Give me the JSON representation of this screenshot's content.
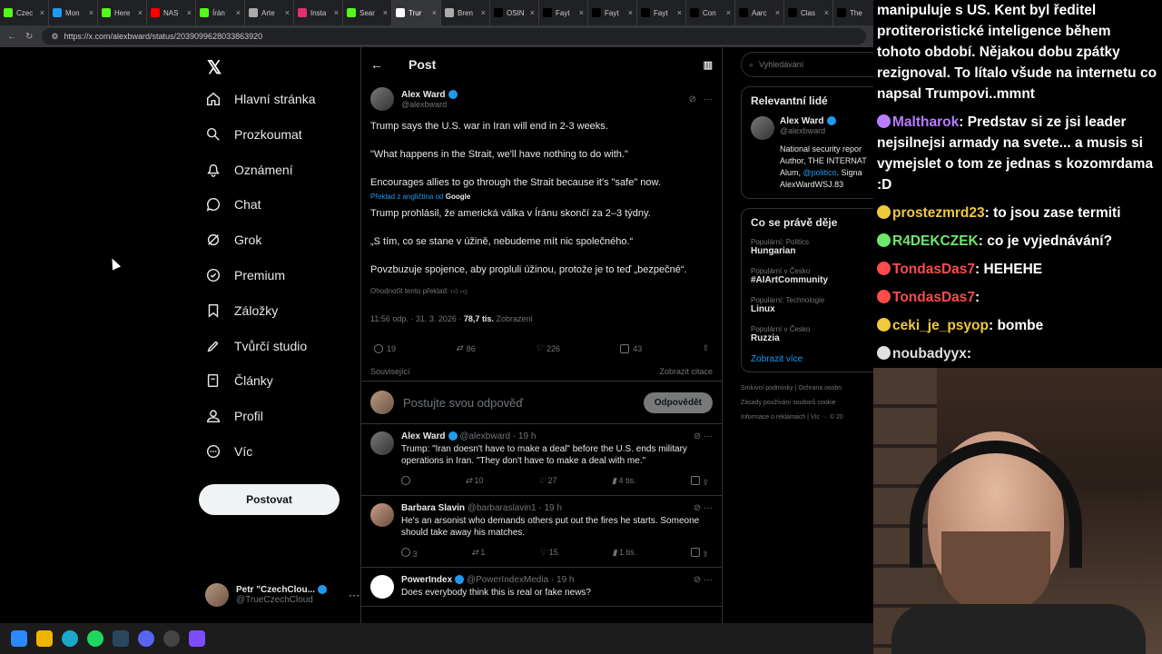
{
  "browser": {
    "tabs": [
      {
        "label": "Czec",
        "color": "#53fc18"
      },
      {
        "label": "Mon",
        "color": "#1d9bf0"
      },
      {
        "label": "Here",
        "color": "#53fc18"
      },
      {
        "label": "NAS",
        "color": "#ff0000"
      },
      {
        "label": "Írán",
        "color": "#53fc18"
      },
      {
        "label": "Arte",
        "color": "#aaaaaa"
      },
      {
        "label": "Insta",
        "color": "#e1306c"
      },
      {
        "label": "Sear",
        "color": "#53fc18"
      },
      {
        "label": "Trur",
        "color": "#ffffff"
      },
      {
        "label": "Bren",
        "color": "#aaaaaa"
      },
      {
        "label": "OSIN",
        "color": "#000000"
      },
      {
        "label": "Fayt",
        "color": "#000000"
      },
      {
        "label": "Fayt",
        "color": "#000000"
      },
      {
        "label": "Fayt",
        "color": "#000000"
      },
      {
        "label": "Con",
        "color": "#000000"
      },
      {
        "label": "Aarc",
        "color": "#000000"
      },
      {
        "label": "Clas",
        "color": "#000000"
      },
      {
        "label": "The",
        "color": "#000000"
      }
    ],
    "url": "https://x.com/alexbward/status/2039099628033863920"
  },
  "nav": {
    "items": [
      {
        "label": "Hlavní stránka",
        "icon": "home-icon"
      },
      {
        "label": "Prozkoumat",
        "icon": "search-icon"
      },
      {
        "label": "Oznámení",
        "icon": "bell-icon"
      },
      {
        "label": "Chat",
        "icon": "chat-icon"
      },
      {
        "label": "Grok",
        "icon": "grok-icon"
      },
      {
        "label": "Premium",
        "icon": "premium-icon"
      },
      {
        "label": "Záložky",
        "icon": "bookmark-icon"
      },
      {
        "label": "Tvůrčí studio",
        "icon": "rocket-icon"
      },
      {
        "label": "Články",
        "icon": "article-icon"
      },
      {
        "label": "Profil",
        "icon": "person-icon"
      },
      {
        "label": "Víc",
        "icon": "more-icon"
      }
    ],
    "post_label": "Postovat",
    "me_name": "Petr \"CzechClou...",
    "me_handle": "@TrueCzechCloud"
  },
  "main": {
    "title": "Post",
    "tweet": {
      "name": "Alex Ward",
      "handle": "@alexbward",
      "p1": "Trump says the U.S. war in Iran will end in 2-3 weeks.",
      "p2": "\"What happens in the Strait, we'll have nothing to do with.\"",
      "p3": "Encourages allies to go through the Strait because it's \"safe\" now.",
      "translated_from": "Překlad z angličtina od",
      "google": "Google",
      "t1": "Trump prohlásil, že americká válka v Íránu skončí za 2–3 týdny.",
      "t2": "„S tím, co se stane v úžině, nebudeme mít nic společného.“",
      "t3": "Povzbuzuje spojence, aby propluli úžinou, protože je to teď „bezpečné“.",
      "rate": "Ohodnoťit tento překlad:",
      "time": "11:56 odp. · 31. 3. 2026 ·",
      "views": "78,7 tis.",
      "views_label": "Zobrazení",
      "replies": "19",
      "reposts": "86",
      "likes": "226",
      "bookmarks": "43",
      "related": "Související",
      "quotes": "Zobrazit citace"
    },
    "reply_placeholder": "Postujte svou odpověď",
    "reply_button": "Odpovědět",
    "replies": [
      {
        "name": "Alex Ward",
        "handle": "@alexbward · 19 h",
        "text": "Trump: \"Iran doesn't have to make a deal\" before the U.S. ends military operations in Iran. \"They don't have to make a deal with me.\"",
        "reposts": "10",
        "likes": "27",
        "views": "4 tis."
      },
      {
        "name": "Barbara Slavin",
        "handle": "@barbaraslavin1 · 19 h",
        "text": "He's an arsonist who demands others put out the fires he starts. Someone should take away his matches.",
        "replies": "3",
        "reposts": "1",
        "likes": "15",
        "views": "1 tis."
      },
      {
        "name": "PowerIndex",
        "handle": "@PowerIndexMedia · 19 h",
        "text": "Does everybody think this is real or fake news?"
      }
    ]
  },
  "right": {
    "search_placeholder": "Vyhledávání",
    "people_title": "Relevantní lidé",
    "person_name": "Alex Ward",
    "person_handle": "@alexbward",
    "person_bio1": "National security repor",
    "person_bio2": "Author, THE INTERNAT",
    "person_bio3a": "Alum, ",
    "person_bio3b": "@politico",
    "person_bio3c": ". Signa",
    "person_bio4": "AlexWardWSJ.83",
    "trends_title": "Co se právě děje",
    "trends": [
      {
        "cat": "Populární: Politics",
        "title": "Hungarian"
      },
      {
        "cat": "Populární v Česko",
        "title": "#AIArtCommunity"
      },
      {
        "cat": "Populární: Technologie",
        "title": "Linux"
      },
      {
        "cat": "Populární v Česko",
        "title": "Ruzzia"
      }
    ],
    "show_more": "Zobrazit více",
    "footer1a": "Smluvní podmínky",
    "footer1b": "Ochrana osobn",
    "footer2": "Zásady používání souborů cookie",
    "footer3a": "Informace o reklamách",
    "footer3b": "Víc ···",
    "footer3c": "© 20"
  },
  "chat": {
    "intro": "manipuluje s US. Kent byl ředitel protiteroristické inteligence během tohoto období. Nějakou dobu zpátky rezignoval. To lítalo všude na internetu co napsal Trumpovi..mmnt",
    "messages": [
      {
        "user": "Maltharok",
        "text": "Predstav si ze jsi leader nejsilnejsi armady na svete... a musis si vymejslet o tom ze jednas s kozomrdama :D",
        "color": "#b97cff"
      },
      {
        "user": "prostezmrd23",
        "text": "to jsou zase termiti",
        "color": "#f0c93c"
      },
      {
        "user": "R4DEKCZEK",
        "text": "co je vyjednávání?",
        "color": "#6ee66e"
      },
      {
        "user": "TondasDas7",
        "text": "HEHEHE",
        "color": "#ff4b4b"
      },
      {
        "user": "TondasDas7",
        "text": "",
        "color": "#ff4b4b"
      },
      {
        "user": "ceki_je_psyop",
        "text": "bombe",
        "color": "#f0c93c"
      },
      {
        "user": "noubadyyx",
        "text": "",
        "color": "#e0e0e0"
      }
    ]
  }
}
